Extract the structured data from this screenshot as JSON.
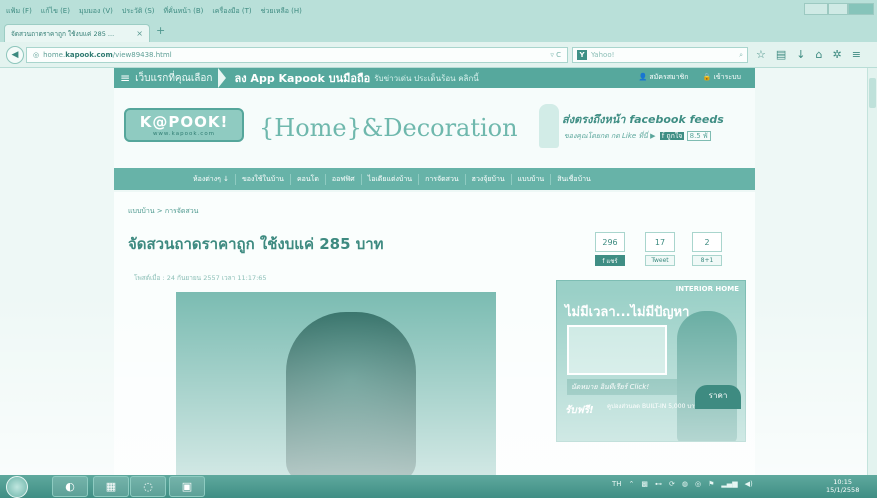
{
  "menubar": {
    "items": [
      "แฟ้ม (F)",
      "แก้ไข (E)",
      "มุมมอง (V)",
      "ประวัติ (S)",
      "ที่คั่นหน้า (B)",
      "เครื่องมือ (T)",
      "ช่วยเหลือ (H)"
    ]
  },
  "tab": {
    "title": "จัดสวนถาดราคาถูก ใช้งบแค่ 285 ...",
    "close": "×",
    "new": "+"
  },
  "nav": {
    "url_prefix": "home.",
    "url_domain": "kapook.com",
    "url_path": "/view89438.html",
    "search_placeholder": "Yahoo!",
    "search_logo": "Y"
  },
  "site": {
    "topbar": {
      "menu_icon": "≡",
      "tagline": "เว็บแรกที่คุณเลือก",
      "app_text": "ลง App Kapook บนมือถือ",
      "app_sub": "รับข่าวเด่น ประเด็นร้อน คลิกนี้",
      "register": "สมัครสมาชิก",
      "login": "เข้าระบบ"
    },
    "logo": {
      "text": "K@POOK!",
      "url": "www.kapook.com"
    },
    "header_title": "{Home}&Decoration",
    "fb_promo": {
      "line1": "ส่งตรงถึงหน้า facebook feeds",
      "line2": "ของคุณโดยกด กด Like ที่นี่ ▶",
      "like": "f ถูกใจ",
      "count": "8.5 พั"
    },
    "categories": [
      "ห้องต่างๆ ↓",
      "ของใช้ในบ้าน",
      "คอนโด",
      "ออฟฟิศ",
      "ไอเดียแต่งบ้าน",
      "การจัดสวน",
      "ฮวงจุ้ยบ้าน",
      "แบบบ้าน",
      "สินเชื่อบ้าน"
    ],
    "breadcrumb": "แบบบ้าน  >  การจัดสวน",
    "article": {
      "title": "จัดสวนถาดราคาถูก ใช้งบแค่ 285 บาท",
      "date": "โพสต์เมื่อ : 24 กันยายน 2557 เวลา 11:17:65"
    },
    "social": {
      "fb_count": "296",
      "fb_label": "f แชร์",
      "tw_count": "17",
      "tw_label": "Tweet",
      "gp_count": "2",
      "gp_label": "8+1"
    },
    "ad": {
      "brand": "INTERIOR HOME",
      "headline": "ไม่มีเวลา...ไม่มีปัญหา",
      "cta": "นัดหมาย อินทีเรียร์ Click!",
      "free": "รับฟรี!",
      "coupon": "คูปองส่วนลด BUILT-IN 5,000 บาท"
    },
    "price_tab": "ราคา"
  },
  "taskbar": {
    "lang": "TH",
    "time": "10:15",
    "date": "15/1/2558"
  },
  "colors": {
    "accent": "#56a89d",
    "tint": "#e8f5f2"
  }
}
